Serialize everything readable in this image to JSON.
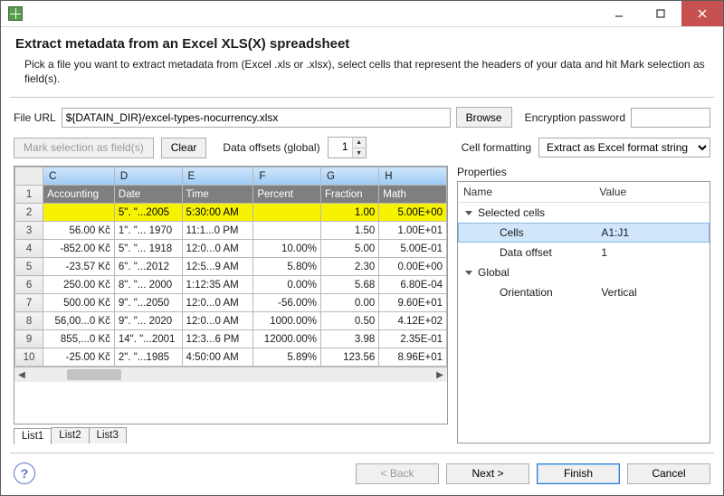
{
  "header": {
    "title": "Extract metadata from an Excel XLS(X) spreadsheet",
    "subtitle": "Pick a file you want to extract metadata from (Excel .xls or .xlsx), select cells that represent the headers of your data and hit Mark selection as field(s)."
  },
  "fileurl": {
    "label": "File URL",
    "value": "${DATAIN_DIR}/excel-types-nocurrency.xlsx",
    "browse": "Browse",
    "enc_label": "Encryption password",
    "enc_value": ""
  },
  "toolbar": {
    "mark_label": "Mark selection as field(s)",
    "clear_label": "Clear",
    "offsets_label": "Data offsets (global)",
    "offsets_value": "1",
    "cellfmt_label": "Cell formatting",
    "cellfmt_value": "Extract as Excel format string"
  },
  "grid": {
    "columns": [
      "C",
      "D",
      "E",
      "F",
      "G",
      "H"
    ],
    "headers_row": [
      "Accounting",
      "Date",
      "Time",
      "Percent",
      "Fraction",
      "Math"
    ],
    "rows": [
      {
        "n": 2,
        "cells": [
          "",
          "5\". \"...2005",
          "5:30:00 AM",
          "",
          "1.00",
          "5.00E+00"
        ],
        "hl": true
      },
      {
        "n": 3,
        "cells": [
          "56.00 Kč",
          "1\". \"... 1970",
          "11:1...0 PM",
          "",
          "1.50",
          "1.00E+01"
        ]
      },
      {
        "n": 4,
        "cells": [
          "-852.00 Kč",
          "5\". \"... 1918",
          "12:0...0 AM",
          "10.00%",
          "5.00",
          "5.00E-01"
        ]
      },
      {
        "n": 5,
        "cells": [
          "-23.57 Kč",
          "6\". \"...2012",
          "12:5...9 AM",
          "5.80%",
          "2.30",
          "0.00E+00"
        ]
      },
      {
        "n": 6,
        "cells": [
          "250.00 Kč",
          "8\". \"... 2000",
          "1:12:35 AM",
          "0.00%",
          "5.68",
          "6.80E-04"
        ]
      },
      {
        "n": 7,
        "cells": [
          "500.00 Kč",
          "9\". \"...2050",
          "12:0...0 AM",
          "-56.00%",
          "0.00",
          "9.60E+01"
        ]
      },
      {
        "n": 8,
        "cells": [
          "56,00...0 Kč",
          "9\". \"... 2020",
          "12:0...0 AM",
          "1000.00%",
          "0.50",
          "4.12E+02"
        ]
      },
      {
        "n": 9,
        "cells": [
          "855,...0 Kč",
          "14\". \"...2001",
          "12:3...6 PM",
          "12000.00%",
          "3.98",
          "2.35E-01"
        ]
      },
      {
        "n": 10,
        "cells": [
          "-25.00 Kč",
          "2\". \"...1985",
          "4:50:00 AM",
          "5.89%",
          "123.56",
          "8.96E+01"
        ]
      }
    ],
    "sheets": [
      "List1",
      "List2",
      "List3"
    ],
    "active_sheet": 0
  },
  "properties": {
    "title": "Properties",
    "name_col": "Name",
    "value_col": "Value",
    "groups": [
      {
        "label": "Selected cells",
        "items": [
          {
            "name": "Cells",
            "value": "A1:J1",
            "selected": true
          },
          {
            "name": "Data offset",
            "value": "1"
          }
        ]
      },
      {
        "label": "Global",
        "items": [
          {
            "name": "Orientation",
            "value": "Vertical"
          }
        ]
      }
    ]
  },
  "footer": {
    "back": "< Back",
    "next": "Next >",
    "finish": "Finish",
    "cancel": "Cancel"
  }
}
